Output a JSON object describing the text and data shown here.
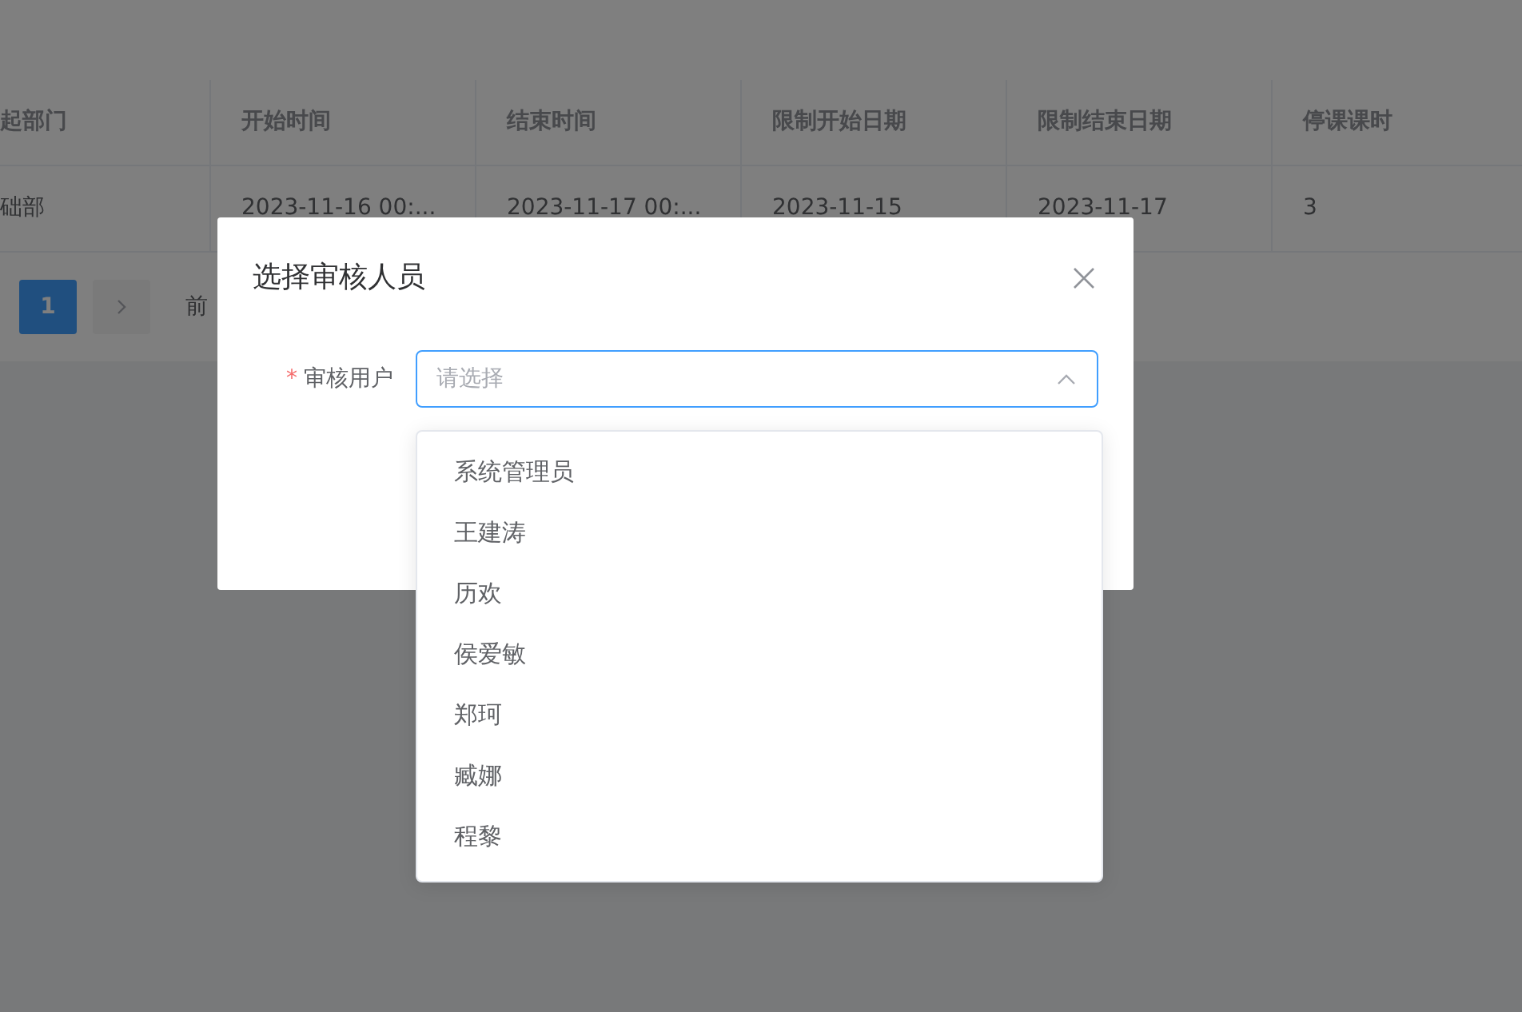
{
  "table": {
    "columns": [
      "起部门",
      "开始时间",
      "结束时间",
      "限制开始日期",
      "限制结束日期",
      "停课课时"
    ],
    "rows": [
      [
        "础部",
        "2023-11-16 00:...",
        "2023-11-17 00:...",
        "2023-11-15",
        "2023-11-17",
        "3"
      ]
    ]
  },
  "pagination": {
    "pages": [
      {
        "label": "1",
        "selected": true
      }
    ],
    "jump_label": "前"
  },
  "dialog": {
    "title": "选择审核人员",
    "field": {
      "label": "审核用户",
      "required": true,
      "required_mark": "*",
      "placeholder": "请选择",
      "expanded": true
    },
    "options": [
      {
        "label": "系统管理员"
      },
      {
        "label": "王建涛"
      },
      {
        "label": "历欢"
      },
      {
        "label": "侯爱敏"
      },
      {
        "label": "郑珂"
      },
      {
        "label": "臧娜"
      },
      {
        "label": "程黎"
      }
    ]
  }
}
